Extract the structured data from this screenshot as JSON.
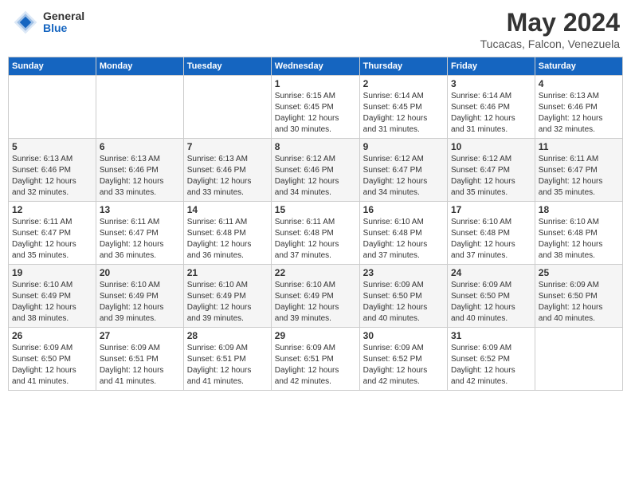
{
  "header": {
    "logo_general": "General",
    "logo_blue": "Blue",
    "month_title": "May 2024",
    "location": "Tucacas, Falcon, Venezuela"
  },
  "days_of_week": [
    "Sunday",
    "Monday",
    "Tuesday",
    "Wednesday",
    "Thursday",
    "Friday",
    "Saturday"
  ],
  "weeks": [
    [
      {
        "day": "",
        "info": ""
      },
      {
        "day": "",
        "info": ""
      },
      {
        "day": "",
        "info": ""
      },
      {
        "day": "1",
        "info": "Sunrise: 6:15 AM\nSunset: 6:45 PM\nDaylight: 12 hours\nand 30 minutes."
      },
      {
        "day": "2",
        "info": "Sunrise: 6:14 AM\nSunset: 6:45 PM\nDaylight: 12 hours\nand 31 minutes."
      },
      {
        "day": "3",
        "info": "Sunrise: 6:14 AM\nSunset: 6:46 PM\nDaylight: 12 hours\nand 31 minutes."
      },
      {
        "day": "4",
        "info": "Sunrise: 6:13 AM\nSunset: 6:46 PM\nDaylight: 12 hours\nand 32 minutes."
      }
    ],
    [
      {
        "day": "5",
        "info": "Sunrise: 6:13 AM\nSunset: 6:46 PM\nDaylight: 12 hours\nand 32 minutes."
      },
      {
        "day": "6",
        "info": "Sunrise: 6:13 AM\nSunset: 6:46 PM\nDaylight: 12 hours\nand 33 minutes."
      },
      {
        "day": "7",
        "info": "Sunrise: 6:13 AM\nSunset: 6:46 PM\nDaylight: 12 hours\nand 33 minutes."
      },
      {
        "day": "8",
        "info": "Sunrise: 6:12 AM\nSunset: 6:46 PM\nDaylight: 12 hours\nand 34 minutes."
      },
      {
        "day": "9",
        "info": "Sunrise: 6:12 AM\nSunset: 6:47 PM\nDaylight: 12 hours\nand 34 minutes."
      },
      {
        "day": "10",
        "info": "Sunrise: 6:12 AM\nSunset: 6:47 PM\nDaylight: 12 hours\nand 35 minutes."
      },
      {
        "day": "11",
        "info": "Sunrise: 6:11 AM\nSunset: 6:47 PM\nDaylight: 12 hours\nand 35 minutes."
      }
    ],
    [
      {
        "day": "12",
        "info": "Sunrise: 6:11 AM\nSunset: 6:47 PM\nDaylight: 12 hours\nand 35 minutes."
      },
      {
        "day": "13",
        "info": "Sunrise: 6:11 AM\nSunset: 6:47 PM\nDaylight: 12 hours\nand 36 minutes."
      },
      {
        "day": "14",
        "info": "Sunrise: 6:11 AM\nSunset: 6:48 PM\nDaylight: 12 hours\nand 36 minutes."
      },
      {
        "day": "15",
        "info": "Sunrise: 6:11 AM\nSunset: 6:48 PM\nDaylight: 12 hours\nand 37 minutes."
      },
      {
        "day": "16",
        "info": "Sunrise: 6:10 AM\nSunset: 6:48 PM\nDaylight: 12 hours\nand 37 minutes."
      },
      {
        "day": "17",
        "info": "Sunrise: 6:10 AM\nSunset: 6:48 PM\nDaylight: 12 hours\nand 37 minutes."
      },
      {
        "day": "18",
        "info": "Sunrise: 6:10 AM\nSunset: 6:48 PM\nDaylight: 12 hours\nand 38 minutes."
      }
    ],
    [
      {
        "day": "19",
        "info": "Sunrise: 6:10 AM\nSunset: 6:49 PM\nDaylight: 12 hours\nand 38 minutes."
      },
      {
        "day": "20",
        "info": "Sunrise: 6:10 AM\nSunset: 6:49 PM\nDaylight: 12 hours\nand 39 minutes."
      },
      {
        "day": "21",
        "info": "Sunrise: 6:10 AM\nSunset: 6:49 PM\nDaylight: 12 hours\nand 39 minutes."
      },
      {
        "day": "22",
        "info": "Sunrise: 6:10 AM\nSunset: 6:49 PM\nDaylight: 12 hours\nand 39 minutes."
      },
      {
        "day": "23",
        "info": "Sunrise: 6:09 AM\nSunset: 6:50 PM\nDaylight: 12 hours\nand 40 minutes."
      },
      {
        "day": "24",
        "info": "Sunrise: 6:09 AM\nSunset: 6:50 PM\nDaylight: 12 hours\nand 40 minutes."
      },
      {
        "day": "25",
        "info": "Sunrise: 6:09 AM\nSunset: 6:50 PM\nDaylight: 12 hours\nand 40 minutes."
      }
    ],
    [
      {
        "day": "26",
        "info": "Sunrise: 6:09 AM\nSunset: 6:50 PM\nDaylight: 12 hours\nand 41 minutes."
      },
      {
        "day": "27",
        "info": "Sunrise: 6:09 AM\nSunset: 6:51 PM\nDaylight: 12 hours\nand 41 minutes."
      },
      {
        "day": "28",
        "info": "Sunrise: 6:09 AM\nSunset: 6:51 PM\nDaylight: 12 hours\nand 41 minutes."
      },
      {
        "day": "29",
        "info": "Sunrise: 6:09 AM\nSunset: 6:51 PM\nDaylight: 12 hours\nand 42 minutes."
      },
      {
        "day": "30",
        "info": "Sunrise: 6:09 AM\nSunset: 6:52 PM\nDaylight: 12 hours\nand 42 minutes."
      },
      {
        "day": "31",
        "info": "Sunrise: 6:09 AM\nSunset: 6:52 PM\nDaylight: 12 hours\nand 42 minutes."
      },
      {
        "day": "",
        "info": ""
      }
    ]
  ]
}
